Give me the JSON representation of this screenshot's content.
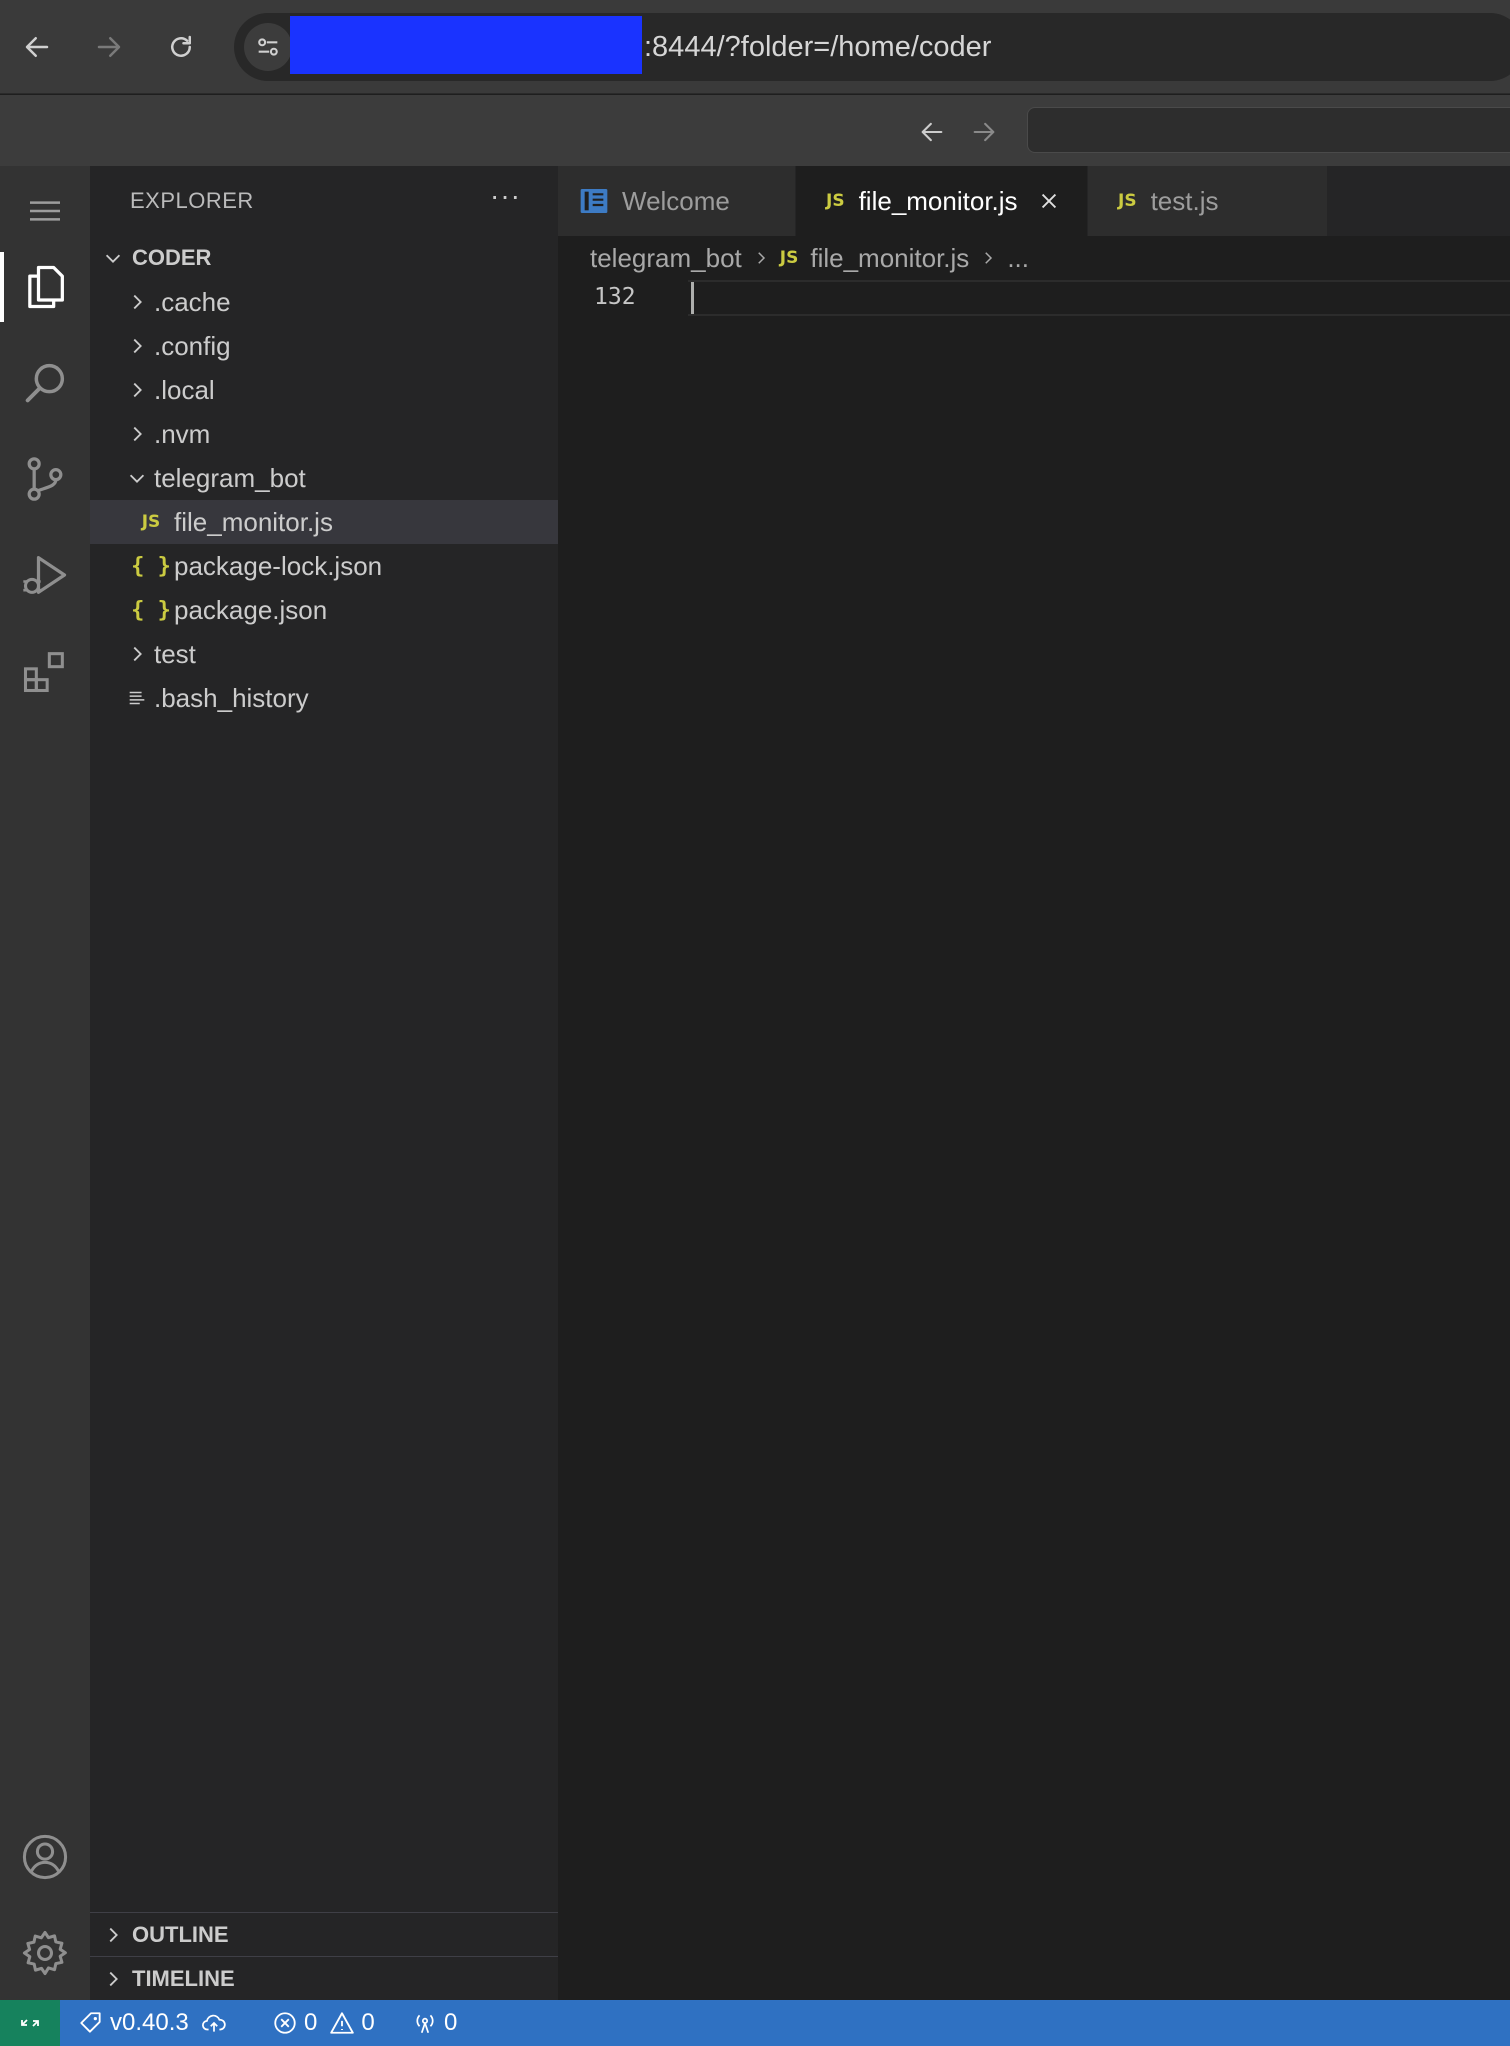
{
  "browser": {
    "url_text": ":8444/?folder=/home/coder"
  },
  "sidebar": {
    "title": "EXPLORER",
    "more": "···",
    "root_label": "CODER",
    "items": [
      {
        "label": ".cache"
      },
      {
        "label": ".config"
      },
      {
        "label": ".local"
      },
      {
        "label": ".nvm"
      },
      {
        "label": "telegram_bot"
      },
      {
        "label": "file_monitor.js",
        "icon": "JS"
      },
      {
        "label": "package-lock.json",
        "icon": "{ }"
      },
      {
        "label": "package.json",
        "icon": "{ }"
      },
      {
        "label": "test"
      },
      {
        "label": ".bash_history"
      }
    ],
    "outline_label": "OUTLINE",
    "timeline_label": "TIMELINE"
  },
  "tabs": [
    {
      "label": "Welcome"
    },
    {
      "label": "file_monitor.js",
      "icon": "JS"
    },
    {
      "label": "test.js",
      "icon": "JS"
    }
  ],
  "breadcrumb": {
    "folder": "telegram_bot",
    "file_icon": "JS",
    "file": "file_monitor.js",
    "more": "..."
  },
  "editor": {
    "line_number": "132"
  },
  "status": {
    "version": "v0.40.3",
    "errors": "0",
    "warnings": "0",
    "ports": "0"
  },
  "colors": {
    "status_bar": "#2f71c2",
    "remote_indicator": "#16825d",
    "js_icon": "#cbcb41",
    "redaction": "#1a33ff"
  }
}
